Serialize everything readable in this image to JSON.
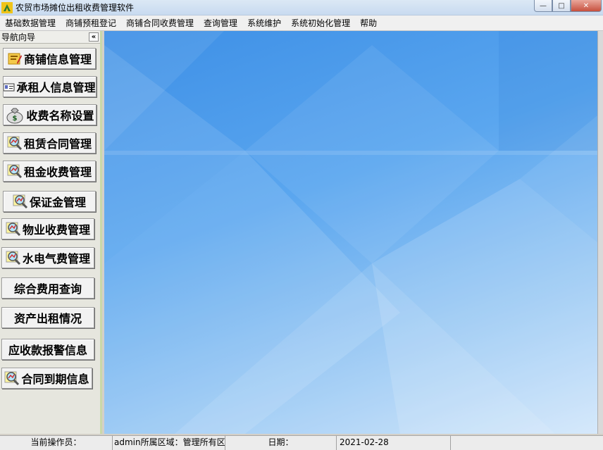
{
  "window": {
    "title": "农贸市场摊位出租收费管理软件",
    "minimize_glyph": "—",
    "maximize_glyph": "□",
    "close_glyph": "✕"
  },
  "menu": {
    "items": [
      "基础数据管理",
      "商铺预租登记",
      "商铺合同收费管理",
      "查询管理",
      "系统维护",
      "系统初始化管理",
      "帮助"
    ]
  },
  "nav": {
    "header": "导航向导",
    "collapse_glyph": "«",
    "buttons": [
      {
        "label": "商铺信息管理",
        "icon": "folder-edit-icon"
      },
      {
        "label": "承租人信息管理",
        "icon": "id-card-icon"
      },
      {
        "label": "收费名称设置",
        "icon": "money-bag-icon"
      },
      {
        "label": "租赁合同管理",
        "icon": "magnifier-chart-icon"
      },
      {
        "label": "租金收费管理",
        "icon": "magnifier-chart-icon"
      },
      {
        "label": "保证金管理",
        "icon": "magnifier-chart-icon"
      },
      {
        "label": "物业收费管理",
        "icon": "magnifier-chart-icon"
      },
      {
        "label": "水电气费管理",
        "icon": "magnifier-chart-icon"
      },
      {
        "label": "综合费用查询",
        "icon": ""
      },
      {
        "label": "资产出租情况",
        "icon": ""
      },
      {
        "label": "应收款报警信息",
        "icon": ""
      },
      {
        "label": "合同到期信息",
        "icon": "magnifier-chart-icon"
      }
    ]
  },
  "status": {
    "operator_label": "当前操作员：",
    "user_area": "admin所属区域：管理所有区",
    "date_label": "日期：",
    "date_value": "2021-02-28"
  },
  "colors": {
    "background_top": "#3d8fe6",
    "background_bottom": "#cfe5fb",
    "nav_background": "#e6e6de"
  }
}
